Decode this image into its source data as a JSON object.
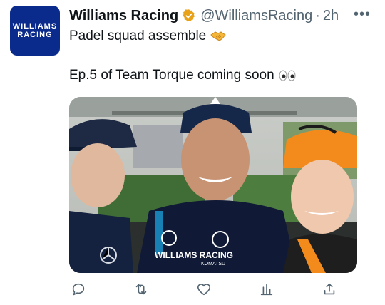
{
  "account": {
    "avatar_text_line1": "WILLIAMS",
    "avatar_text_line2": "RACING",
    "display_name": "Williams Racing",
    "handle": "@WilliamsRacing",
    "separator": "·",
    "timestamp": "2h",
    "verified_color": "#e8a21a"
  },
  "tweet": {
    "line1": "Padel squad assemble",
    "line1_emoji": "handshake",
    "line2": "Ep.5 of Team Torque coming soon",
    "line2_emoji": "eyes"
  },
  "media": {
    "description_text": [
      {
        "name": "williams-chest-logo",
        "text": "WILLIAMS RACING"
      },
      {
        "name": "sponsor-text",
        "text": "KOMATSU"
      }
    ]
  },
  "actions": [
    {
      "name": "reply-icon"
    },
    {
      "name": "retweet-icon"
    },
    {
      "name": "like-icon"
    },
    {
      "name": "views-icon"
    },
    {
      "name": "share-icon"
    }
  ],
  "colors": {
    "accent": "#1d9bf0",
    "secondary_text": "#536471",
    "avatar_bg": "#0a2a8c"
  }
}
